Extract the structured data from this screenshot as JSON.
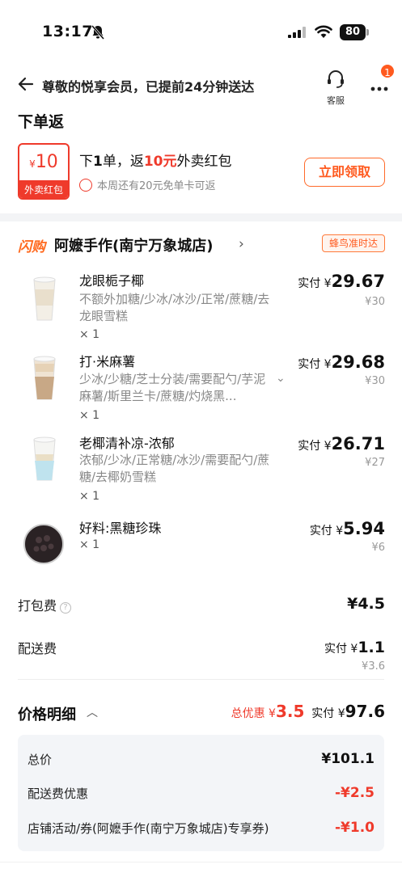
{
  "status_bar": {
    "time": "13:17",
    "battery": "80"
  },
  "header": {
    "title_prefix": "尊敬的悦享会员，已提前",
    "title_minutes": "24",
    "title_suffix": "分钟送达",
    "customer_service": "客服",
    "badge_count": "1"
  },
  "rebate": {
    "title": "下单返",
    "coupon_currency": "¥",
    "coupon_amount": "10",
    "coupon_label": "外卖红包",
    "main_1": "下",
    "main_2": "1",
    "main_3": "单，返",
    "main_4": "10元",
    "main_5": "外卖红包",
    "sub": "本周还有20元免单卡可返",
    "claim_button": "立即领取"
  },
  "store": {
    "tag": "闪购",
    "name": "阿嬷手作(南宁万象城店)",
    "delivery_badge": "蜂鸟准时达"
  },
  "items": [
    {
      "name": "龙眼栀子椰",
      "spec": "不额外加糖/少冰/冰沙/正常/蔗糖/去龙眼雪糕",
      "qty": "× 1",
      "paid_label": "实付 ¥",
      "paid": "29.67",
      "original": "¥30"
    },
    {
      "name": "打·米麻薯",
      "spec": "少冰/少糖/芝士分装/需要配勺/芋泥麻薯/斯里兰卡/蔗糖/灼烧黑...",
      "qty": "× 1",
      "paid_label": "实付 ¥",
      "paid": "29.68",
      "original": "¥30"
    },
    {
      "name": "老椰清补凉-浓郁",
      "spec": "浓郁/少冰/正常糖/冰沙/需要配勺/蔗糖/去椰奶雪糕",
      "qty": "× 1",
      "paid_label": "实付 ¥",
      "paid": "26.71",
      "original": "¥27"
    },
    {
      "name": "好料:黑糖珍珠",
      "spec": "",
      "qty": "× 1",
      "paid_label": "实付 ¥",
      "paid": "5.94",
      "original": "¥6"
    }
  ],
  "fees": {
    "packing_label": "打包费",
    "packing_value": "¥4.5",
    "delivery_label": "配送费",
    "delivery_paid_label": "实付 ¥",
    "delivery_paid": "1.1",
    "delivery_original": "¥3.6"
  },
  "price_detail": {
    "title": "价格明细",
    "discount_label": "总优惠 ¥",
    "discount_value": "3.5",
    "paid_label": "实付 ¥",
    "paid_value": "97.6",
    "rows": [
      {
        "label": "总价",
        "value": "¥101.1"
      },
      {
        "label": "配送费优惠",
        "value": "-¥2.5"
      },
      {
        "label": "店铺活动/券(阿嬷手作(南宁万象城店)专享券)",
        "value": "-¥1.0"
      }
    ]
  },
  "colors": {
    "accent_red": "#ef3a2b",
    "accent_orange": "#ff5a1f"
  }
}
